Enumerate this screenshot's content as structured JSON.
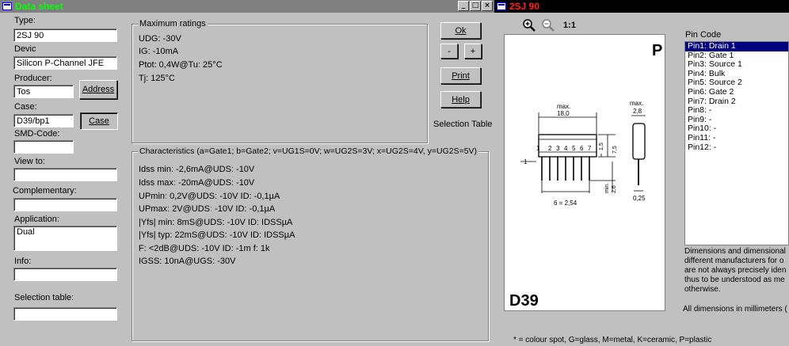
{
  "left_window": {
    "title": "Data sheet",
    "buttons": {
      "min": "_",
      "max": "□",
      "close": "×"
    }
  },
  "form": {
    "type_label": "Type:",
    "type_value": "2SJ 90",
    "device_label": "Devic",
    "device_value": "Silicon P-Channel JFE",
    "producer_label": "Producer:",
    "producer_value": "Tos",
    "address_button": "Address",
    "case_label": "Case:",
    "case_value": "D39/bp1",
    "case_button": "Case",
    "smd_label": "SMD-Code:",
    "smd_value": "",
    "view_label": "View to:",
    "view_value": "",
    "complementary_label": "Complementary:",
    "complementary_value": "",
    "application_label": "Application:",
    "application_value": "Dual",
    "info_label": "Info:",
    "info_value": "",
    "selection_label": "Selection table:",
    "selection_value": ""
  },
  "max_ratings": {
    "title": "Maximum ratings",
    "lines": [
      "UDG: -30V",
      "IG: -10mA",
      "Ptot: 0,4W@Tu: 25°C",
      "Tj: 125°C"
    ]
  },
  "characteristics": {
    "title": "Characteristics (a=Gate1; b=Gate2; v=UG1S=0V; w=UG2S=3V; x=UG2S=4V, y=UG2S=5V)",
    "lines": [
      "Idss min: -2,6mA@UDS: -10V",
      "Idss max: -20mA@UDS: -10V",
      "UPmin: 0,2V@UDS: -10V ID: -0,1µA",
      "UPmax: 2V@UDS: -10V ID: -0,1µA",
      "|Yfs| min: 8mS@UDS: -10V ID: IDSSµA",
      "|Yfs| typ: 22mS@UDS: -10V ID: IDSSµA",
      "F: <2dB@UDS: -10V ID: -1m f: 1k",
      "IGSS: 10nA@UGS: -30V"
    ]
  },
  "actions": {
    "ok": "Ok",
    "minus": "-",
    "plus": "+",
    "print": "Print",
    "help": "Help",
    "selection_table": "Selection Table"
  },
  "right_window": {
    "title": "2SJ 90",
    "zoom_reset": "1:1"
  },
  "drawing": {
    "package_letter": "P",
    "case_code": "D39",
    "dim_max_label": "max.",
    "dim_length": "18,0",
    "dim_depth": "2,8",
    "dim_h1": "1,5",
    "dim_h2": "7,5",
    "dim_lead": "2,6",
    "dim_min_label": "min.",
    "dim_thick": "0,25",
    "pitch_label": "6 = 2,54",
    "pin_numbers": [
      "1",
      "2",
      "3",
      "4",
      "5",
      "6",
      "7"
    ],
    "side_label": "1"
  },
  "pin_code": {
    "label": "Pin Code",
    "pins": [
      "Pin1: Drain 1",
      "Pin2: Gate 1",
      "Pin3: Source 1",
      "Pin4: Bulk",
      "Pin5: Source 2",
      "Pin6: Gate 2",
      "Pin7: Drain 2",
      "Pin8: -",
      "Pin9: -",
      "Pin10: -",
      "Pin11: -",
      "Pin12: -"
    ]
  },
  "notes": {
    "dimensions_lines": [
      "Dimensions and dimensional",
      "different manufacturers for o",
      "are not always precisely iden",
      "thus to be understood as me",
      "otherwise."
    ],
    "millimeters": "All dimensions in millimeters (",
    "legend": "* = colour spot, G=glass, M=metal, K=ceramic, P=plastic"
  },
  "colors": {
    "window_bg": "#c0c0c0",
    "left_title_bar": "#808080",
    "left_title_text": "#00ff00",
    "right_title_bar": "#000000",
    "right_title_text": "#ff2020",
    "selection": "#000080"
  }
}
